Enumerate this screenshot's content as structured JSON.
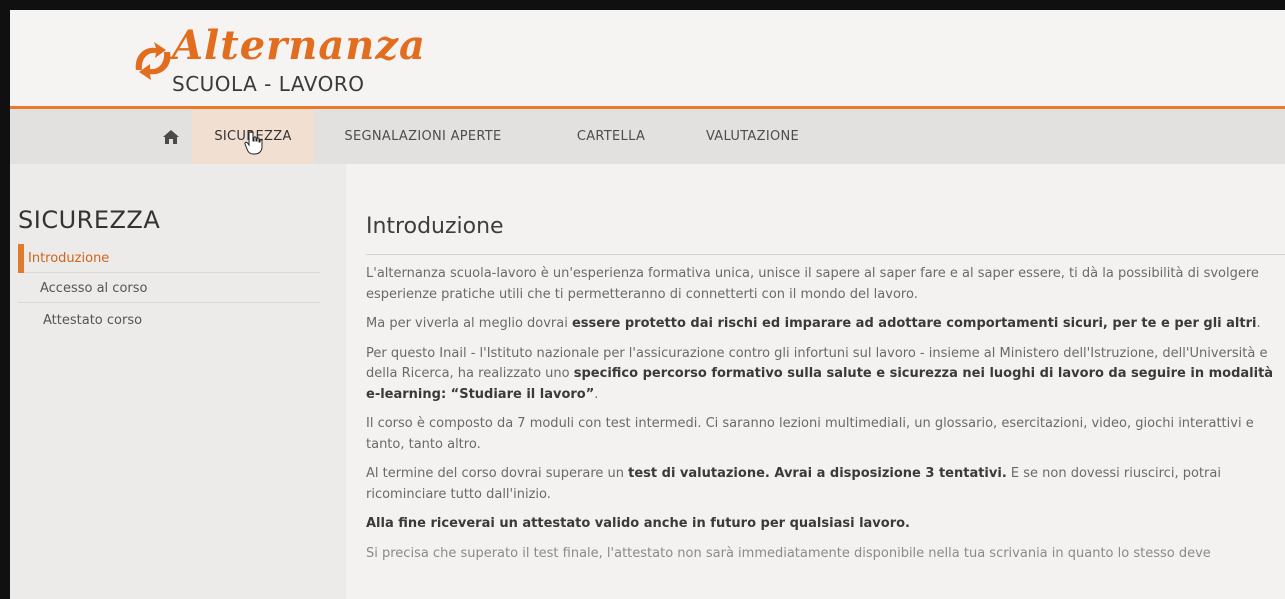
{
  "logo": {
    "script": "Alternanza",
    "subtitle": "SCUOLA - LAVORO"
  },
  "nav": {
    "home_icon": "home-icon",
    "items": [
      {
        "label": "SICUREZZA",
        "active": true
      },
      {
        "label": "SEGNALAZIONI APERTE"
      },
      {
        "label": "CARTELLA"
      },
      {
        "label": "VALUTAZIONE"
      }
    ]
  },
  "sidebar": {
    "title": "SICUREZZA",
    "items": [
      {
        "label": "Introduzione",
        "active": true
      },
      {
        "label": "Accesso al corso"
      },
      {
        "label": "Attestato corso"
      }
    ]
  },
  "main": {
    "title": "Introduzione",
    "paragraphs": {
      "p1": "L'alternanza scuola-lavoro è un'esperienza formativa unica, unisce il sapere al saper fare e al saper essere, ti dà la possibilità di svolgere esperienze pratiche utili che ti permetteranno di connetterti con il mondo del lavoro.",
      "p2_a": "Ma per viverla al meglio dovrai ",
      "p2_b": "essere protetto dai rischi ed imparare ad adottare comportamenti sicuri, per te e per gli altri",
      "p2_c": ".",
      "p3_a": "Per questo Inail - l'Istituto nazionale per l'assicurazione contro gli infortuni sul lavoro - insieme al Ministero dell'Istruzione, dell'Università e della Ricerca, ha realizzato uno ",
      "p3_b": "specifico percorso formativo sulla salute e sicurezza nei luoghi di lavoro da seguire in modalità e-learning: “Studiare il lavoro”",
      "p3_c": ".",
      "p4": "Il corso è composto da 7 moduli con test intermedi. Ci saranno lezioni multimediali, un glossario, esercitazioni, video, giochi interattivi e tanto, tanto altro.",
      "p5_a": "Al termine del corso dovrai superare un ",
      "p5_b": "test di valutazione. Avrai a disposizione 3 tentativi.",
      "p5_c": " E se non dovessi riuscirci, potrai ricominciare tutto dall'inizio.",
      "p6": "Alla fine riceverai un attestato valido anche in futuro per qualsiasi lavoro.",
      "p7": "Si precisa che superato il test finale, l'attestato non sarà immediatamente disponibile nella tua scrivania in quanto lo stesso deve"
    }
  },
  "colors": {
    "accent": "#e36d1f",
    "nav_active_bg": "#f1e0d2"
  }
}
